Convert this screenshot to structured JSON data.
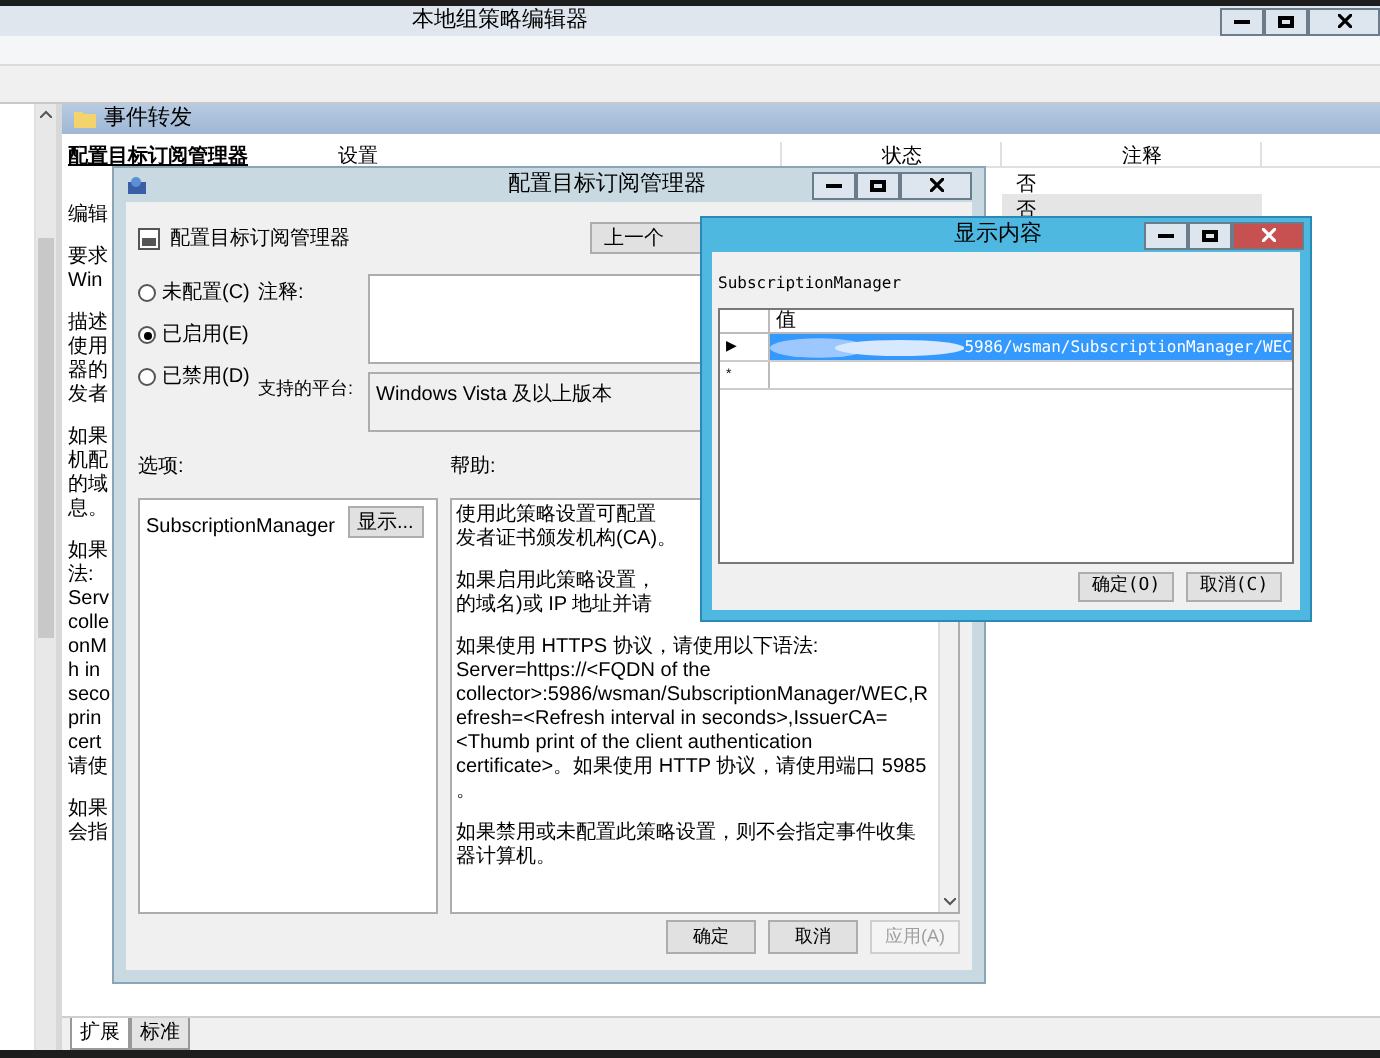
{
  "main_window": {
    "title": "本地组策略编辑器"
  },
  "pane": {
    "heading": "事件转发",
    "policy_title": "配置目标订阅管理器",
    "description_fragments": [
      [
        "编辑"
      ],
      [
        "要求",
        "Win"
      ],
      [
        "描述",
        "使用",
        "器的",
        "发者"
      ],
      [
        "如果",
        "机配",
        "的域",
        "息。"
      ],
      [
        "如果",
        "法:",
        "Serv",
        "colle",
        "onM",
        "h in",
        "seco",
        "prin",
        "cert",
        "请使"
      ],
      [
        "如果",
        "会指"
      ]
    ]
  },
  "table": {
    "columns": [
      "设置",
      "状态",
      "注释"
    ],
    "rows": [
      {
        "column_3": "否",
        "selected": false
      },
      {
        "column_3": "否",
        "selected": true
      }
    ]
  },
  "policy_dialog": {
    "title": "配置目标订阅管理器",
    "heading": "配置目标订阅管理器",
    "prev_button": "上一个",
    "radios": [
      {
        "label": "未配置(C)",
        "selected": false
      },
      {
        "label": "已启用(E)",
        "selected": true
      },
      {
        "label": "已禁用(D)",
        "selected": false
      }
    ],
    "comment_label": "注释:",
    "platform_label": "支持的平台:",
    "platform": "Windows Vista 及以上版本",
    "options_label": "选项:",
    "help_label": "帮助:",
    "option": {
      "label": "SubscriptionManager",
      "button": "显示..."
    },
    "help": [
      {
        "kind": "lines",
        "lines": [
          "使用此策略设置可配置",
          "发者证书颁发机构(CA)。"
        ]
      },
      {
        "kind": "lines",
        "lines": [
          "如果启用此策略设置，",
          "的域名)或 IP 地址并请"
        ]
      },
      {
        "kind": "text",
        "text": "如果使用 HTTPS 协议，请使用以下语法: Server=https://<FQDN of the collector>:5986/wsman/SubscriptionManager/WEC,Refresh=<Refresh interval in seconds>,IssuerCA=<Thumb print of the client authentication certificate>。如果使用 HTTP 协议，请使用端口 5985 。"
      },
      {
        "kind": "text",
        "text": "如果禁用或未配置此策略设置，则不会指定事件收集器计算机。"
      }
    ],
    "buttons": [
      {
        "label": "确定",
        "disabled": false
      },
      {
        "label": "取消",
        "disabled": false
      },
      {
        "label": "应用(A)",
        "disabled": true
      }
    ]
  },
  "show_dialog": {
    "title": "显示内容",
    "name": "SubscriptionManager",
    "column": "值",
    "rows": [
      {
        "marker": "▶",
        "value": "5986/wsman/SubscriptionManager/WEC",
        "selected": true,
        "redacted": true
      },
      {
        "marker": "*",
        "selected": false,
        "redacted": false
      }
    ],
    "buttons": [
      "确定(O)",
      "取消(C)"
    ]
  },
  "bottom_tabs": [
    {
      "label": "扩展",
      "selected": true
    },
    {
      "label": "标准",
      "selected": false
    }
  ]
}
